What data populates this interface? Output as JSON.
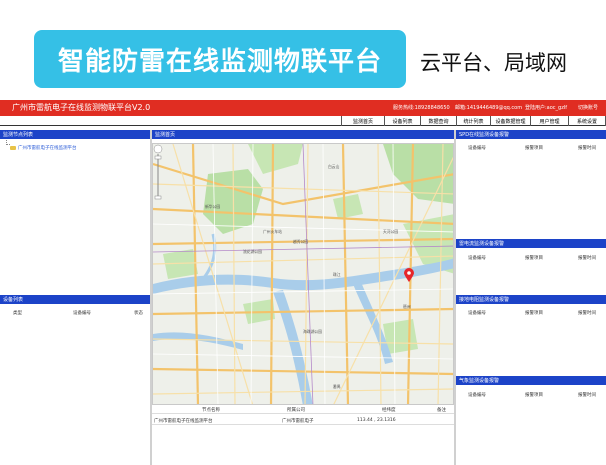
{
  "banner": {
    "title": "智能防雷在线监测物联平台",
    "subtitle": "云平台、局域网"
  },
  "header": {
    "title": "广州市雷航电子在线监测物联平台V2.0",
    "phone": "服务热线:18928848650",
    "email": "邮箱:1419446489@qq.com",
    "user": "登陆用户:aoc_gzlf",
    "logout": "切换账号"
  },
  "menu": [
    "监测首页",
    "设备列表",
    "数据查询",
    "统计列表",
    "设备数据管理",
    "用户管理",
    "系统设置"
  ],
  "left": {
    "node_panel_title": "监测节点列表",
    "tree_item": "广州市雷航电子在线监测平台",
    "device_panel_title": "设备列表",
    "device_columns": [
      "类型",
      "设备编号",
      "状态"
    ]
  },
  "center": {
    "map_title": "监测首页",
    "map_labels": [
      "新华公园",
      "广州火车站",
      "流花湖公园",
      "越秀公园",
      "海珠湖公园",
      "珠江",
      "天河公园",
      "白云山",
      "琶洲",
      "番禺"
    ],
    "table_columns": [
      "节点名称",
      "所属公司",
      "经纬度",
      "备注"
    ],
    "table_rows": [
      {
        "name": "广州市雷航电子在线监测平台",
        "company": "广州市雷航电子",
        "coord": "113.44 , 23.1316",
        "note": ""
      }
    ]
  },
  "right": {
    "panels": [
      {
        "title": "SPD在线监测设备报警",
        "columns": [
          "设备编号",
          "报警项目",
          "报警时间"
        ]
      },
      {
        "title": "雷电流监测设备报警",
        "columns": [
          "设备编号",
          "报警项目",
          "报警时间"
        ]
      },
      {
        "title": "接地电阻监测设备报警",
        "columns": [
          "设备编号",
          "报警项目",
          "报警时间"
        ]
      },
      {
        "title": "气象监测设备报警",
        "columns": [
          "设备编号",
          "报警项目",
          "报警时间"
        ]
      }
    ]
  },
  "colors": {
    "header_red": "#e02d22",
    "panel_blue": "#1c43c8",
    "banner_cyan": "#35c0e6"
  },
  "icons": {
    "map_marker": "red-map-pin-icon",
    "tree_folder": "folder-icon"
  }
}
